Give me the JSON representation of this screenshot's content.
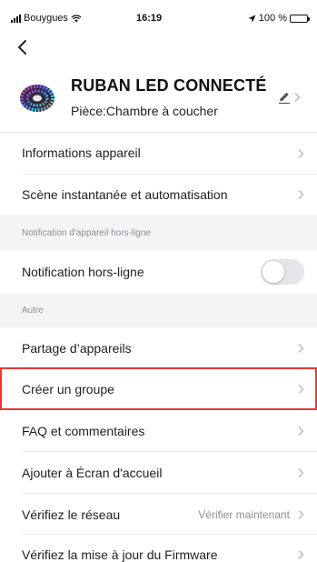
{
  "status_bar": {
    "carrier": "Bouygues",
    "time": "16:19",
    "battery": "100 %"
  },
  "device": {
    "name": "RUBAN LED CONNECTÉ",
    "room": "Pièce:Chambre à coucher"
  },
  "menu": {
    "info": "Informations appareil",
    "scene": "Scène instantanée et automatisation",
    "offline_section": "Notification d'appareil hors-ligne",
    "offline_notification": "Notification hors-ligne",
    "offline_notification_on": false,
    "other_section": "Autre",
    "share": "Partage d’appareils",
    "create_group": "Créer un groupe",
    "faq": "FAQ et commentaires",
    "home_screen": "Ajouter à Écran d'accueil",
    "network": "Vérifiez le réseau",
    "network_action": "Vérifier maintenant",
    "firmware": "Vérifiez la mise à jour du Firmware"
  },
  "colors": {
    "highlight": "#e53935",
    "toggle_off": "#e5e5ea",
    "section_bg": "#f4f4f6"
  }
}
